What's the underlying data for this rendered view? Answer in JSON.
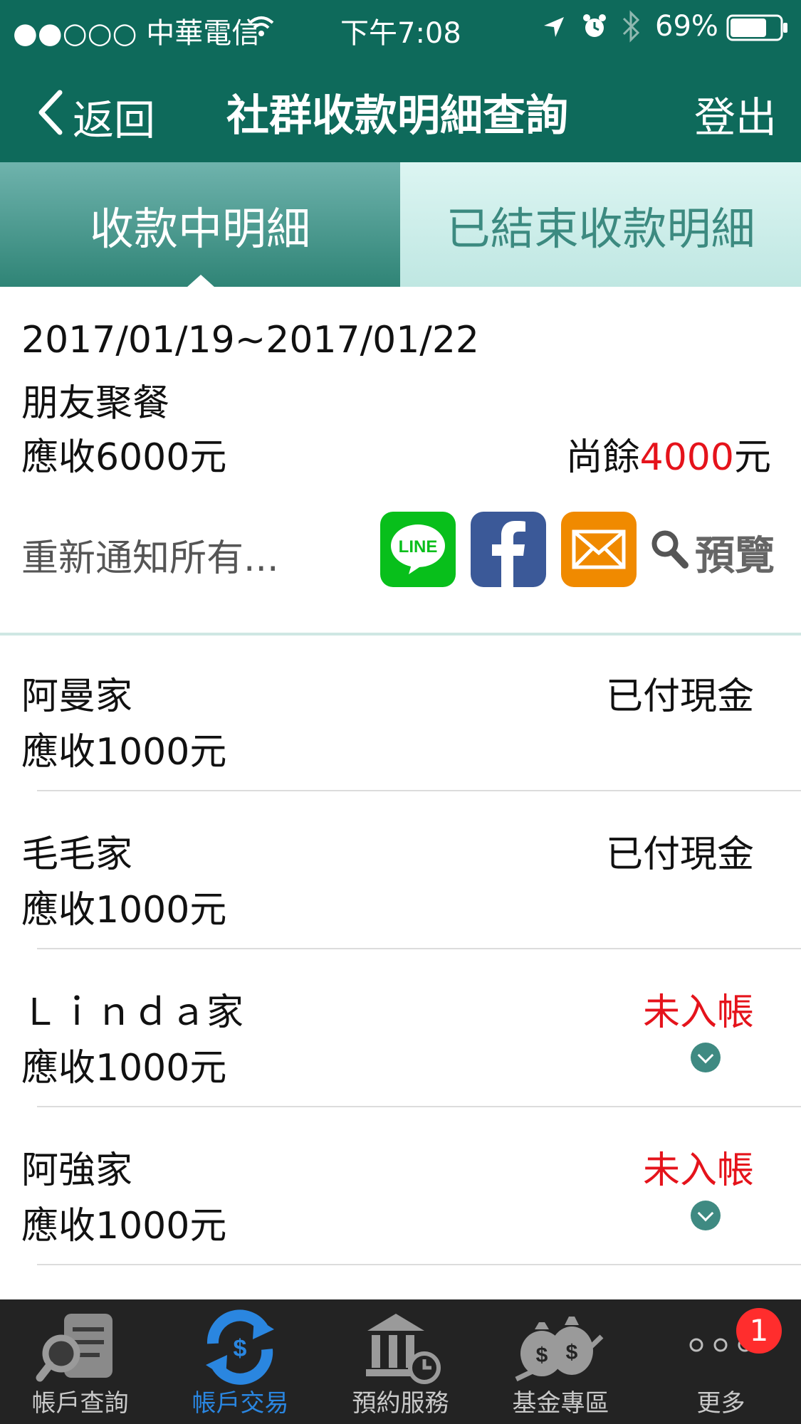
{
  "status_bar": {
    "carrier": "●●○○○ 中華電信",
    "time": "下午7:08",
    "battery_percent": "69%"
  },
  "nav": {
    "back_label": "返回",
    "title": "社群收款明細查詢",
    "logout_label": "登出"
  },
  "tabs": [
    {
      "label": "收款中明細",
      "active": true
    },
    {
      "label": "已結束收款明細",
      "active": false
    }
  ],
  "event": {
    "date_range": "2017/01/19~2017/01/22",
    "name": "朋友聚餐",
    "receivable": "應收6000元",
    "remaining_prefix": "尚餘",
    "remaining_amount": "4000",
    "remaining_suffix": "元"
  },
  "notify": {
    "label": "重新通知所有...",
    "line_label": "LINE",
    "preview_label": "預覽"
  },
  "rows": [
    {
      "name": "阿曼家",
      "amount": "應收1000元",
      "status": "已付現金",
      "unpaid": false
    },
    {
      "name": "毛毛家",
      "amount": "應收1000元",
      "status": "已付現金",
      "unpaid": false
    },
    {
      "name": "Ｌｉｎｄａ家",
      "amount": "應收1000元",
      "status": "未入帳",
      "unpaid": true
    },
    {
      "name": "阿強家",
      "amount": "應收1000元",
      "status": "未入帳",
      "unpaid": true
    }
  ],
  "tab_bar": {
    "items": [
      {
        "label": "帳戶查詢",
        "icon": "scroll-search-icon",
        "active": false
      },
      {
        "label": "帳戶交易",
        "icon": "currency-exchange-icon",
        "active": true
      },
      {
        "label": "預約服務",
        "icon": "bank-clock-icon",
        "active": false
      },
      {
        "label": "基金專區",
        "icon": "money-bags-icon",
        "active": false
      },
      {
        "label": "更多",
        "icon": "more-dots-icon",
        "active": false
      }
    ],
    "badge": "1"
  },
  "colors": {
    "header_green": "#0e6a5b",
    "accent_red": "#e5131b",
    "active_tab_blue": "#2a86e0"
  }
}
